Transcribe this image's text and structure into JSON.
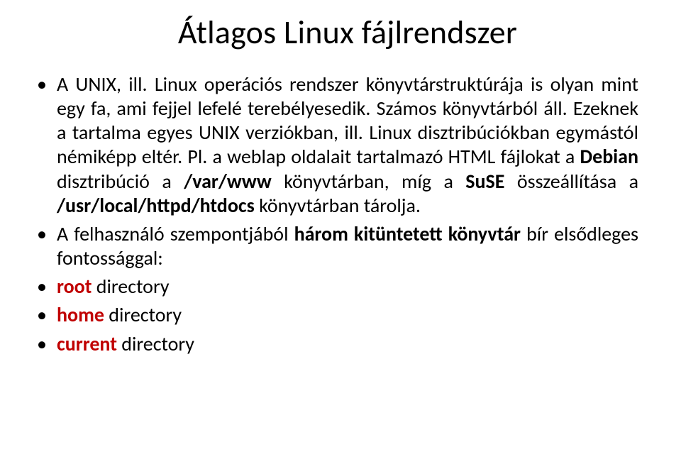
{
  "title": "Átlagos Linux fájlrendszer",
  "bullets": {
    "b1": {
      "pre": "A UNIX, ill. Linux operációs rendszer könyvtárstruktúrája is olyan mint egy fa, ami fejjel lefelé terebélyesedik. Számos könyvtárból áll. Ezeknek a tartalma egyes UNIX verziókban, ill. Linux disztribúciókban egymástól némiképp eltér. Pl. a weblap oldalait tartalmazó HTML fájlokat a ",
      "strong1": "Debian",
      "mid1": " disztribúció a ",
      "strong2": "/var/www",
      "mid2": " könyvtárban, míg a ",
      "strong3": "SuSE",
      "mid3": " összeállítása a ",
      "strong4": "/usr/local/httpd/htdocs",
      "post": " könyvtárban tárolja."
    },
    "b2": {
      "pre": "A felhasználó szempontjából ",
      "strong": "három kitüntetett könyvtár",
      "post": " bír elsődleges fontossággal:"
    },
    "b3": {
      "strong": "root",
      "rest": " directory"
    },
    "b4": {
      "strong": "home",
      "rest": " directory"
    },
    "b5": {
      "strong": "current",
      "rest": " directory"
    }
  }
}
